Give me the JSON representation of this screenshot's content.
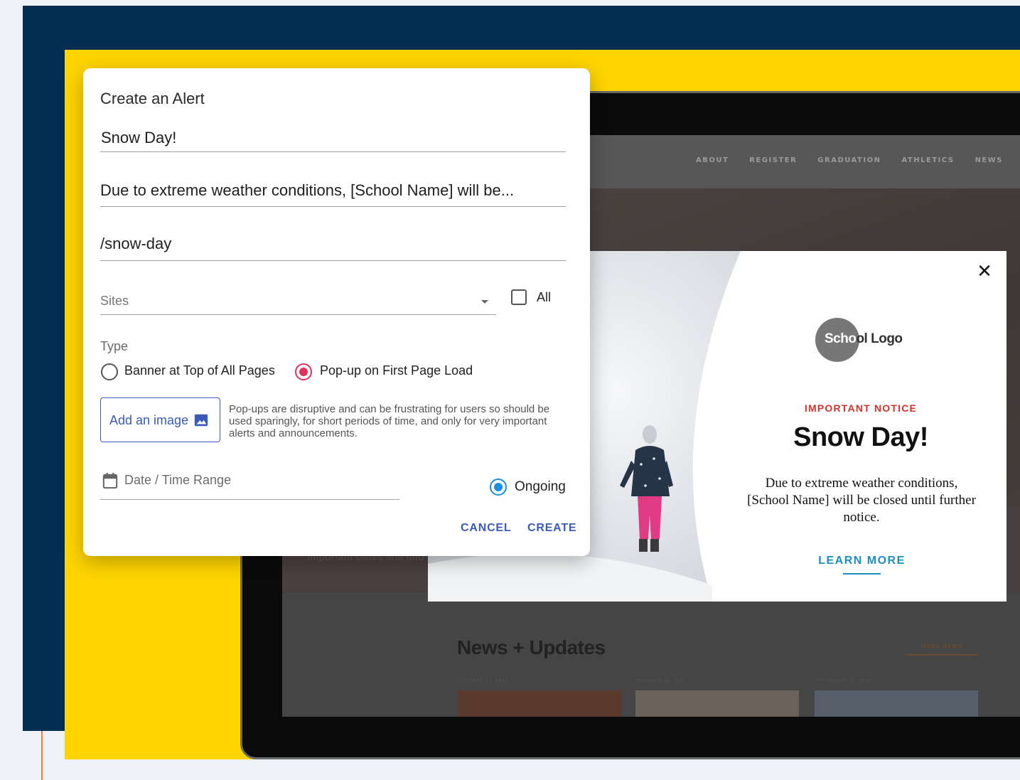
{
  "dialog": {
    "title": "Create an Alert",
    "title_value": "Snow Day!",
    "message_value": "Due to extreme weather conditions, [School Name] will be...",
    "url_value": "/snow-day",
    "sites_placeholder": "Sites",
    "all_label": "All",
    "all_checked": false,
    "type_label": "Type",
    "type_options": [
      {
        "label": "Banner at Top of All Pages",
        "selected": false
      },
      {
        "label": "Pop-up on First Page Load",
        "selected": true
      }
    ],
    "add_image_label": "Add an image",
    "help_text": "Pop-ups are disruptive and can be frustrating for users so should be used sparingly, for short periods of time, and only for very important alerts and announcements.",
    "date_placeholder": "Date / Time Range",
    "ongoing_label": "Ongoing",
    "ongoing_selected": true,
    "cancel_label": "CANCEL",
    "create_label": "CREATE",
    "accent_color": "#3b5bb8"
  },
  "site": {
    "nav": [
      "ABOUT",
      "REGISTER",
      "GRADUATION",
      "ATHLETICS",
      "NEWS"
    ],
    "hero_sub": "Important Dates and Info",
    "news_title": "News + Updates",
    "more_news": "MORE NEWS",
    "card_dates": [
      "OCTOBER 22, 2021",
      "OCTOBER 18, 2021",
      "SEPTEMBER 15, 2021"
    ]
  },
  "popup": {
    "close_icon": "close-icon",
    "logo_text_a": "Scho",
    "logo_text_b": "ol Logo",
    "notice_label": "IMPORTANT NOTICE",
    "heading": "Snow Day!",
    "body": "Due to extreme weather conditions, [School Name] will be closed until further notice.",
    "learn_more": "LEARN MORE",
    "notice_color": "#d0342c",
    "link_color": "#1a8fc2"
  },
  "colors": {
    "navy": "#022f51",
    "yellow": "#fed500",
    "orange": "#f07d2a"
  }
}
